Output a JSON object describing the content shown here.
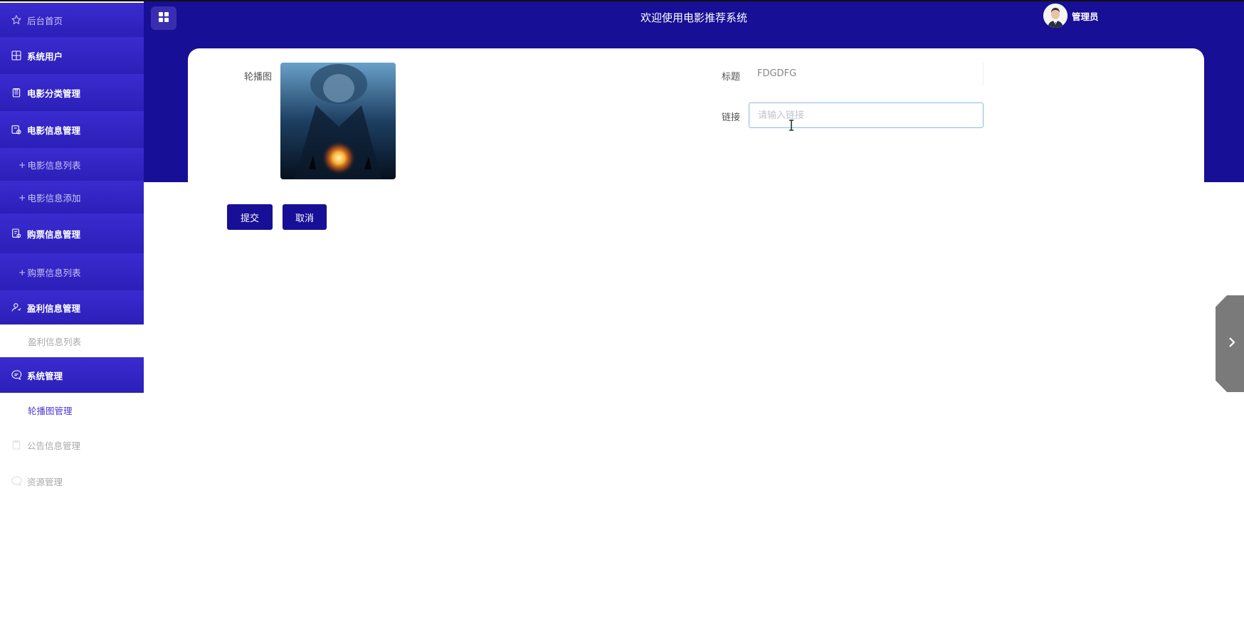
{
  "sidebar": {
    "items": [
      {
        "label": "后台首页",
        "icon": "star-icon"
      },
      {
        "label": "系统用户",
        "icon": "grid-icon"
      },
      {
        "label": "电影分类管理",
        "icon": "clipboard-icon"
      },
      {
        "label": "电影信息管理",
        "icon": "calendar-clock-icon"
      },
      {
        "label": "电影信息列表"
      },
      {
        "label": "电影信息添加"
      },
      {
        "label": "购票信息管理",
        "icon": "document-search-icon"
      },
      {
        "label": "购票信息列表"
      },
      {
        "label": "盈利信息管理",
        "icon": "user-icon"
      },
      {
        "label": "盈利信息列表"
      },
      {
        "label": "系统管理",
        "icon": "chat-icon"
      },
      {
        "label": "轮播图管理"
      },
      {
        "label": "公告信息管理",
        "icon": "clipboard-icon"
      },
      {
        "label": "资源管理",
        "icon": "chat-icon"
      }
    ]
  },
  "header": {
    "title": "欢迎使用电影推荐系统",
    "user": "管理员"
  },
  "form": {
    "image_label": "轮播图",
    "title_label": "标题",
    "title_value": "FDGDFG",
    "link_label": "链接",
    "link_placeholder": "请输入链接",
    "link_value": ""
  },
  "buttons": {
    "submit": "提交",
    "cancel": "取消"
  },
  "colors": {
    "header_bg": "#170f96",
    "sidebar_bg": "#2b1fb8",
    "active_text": "#4a3ad6"
  }
}
